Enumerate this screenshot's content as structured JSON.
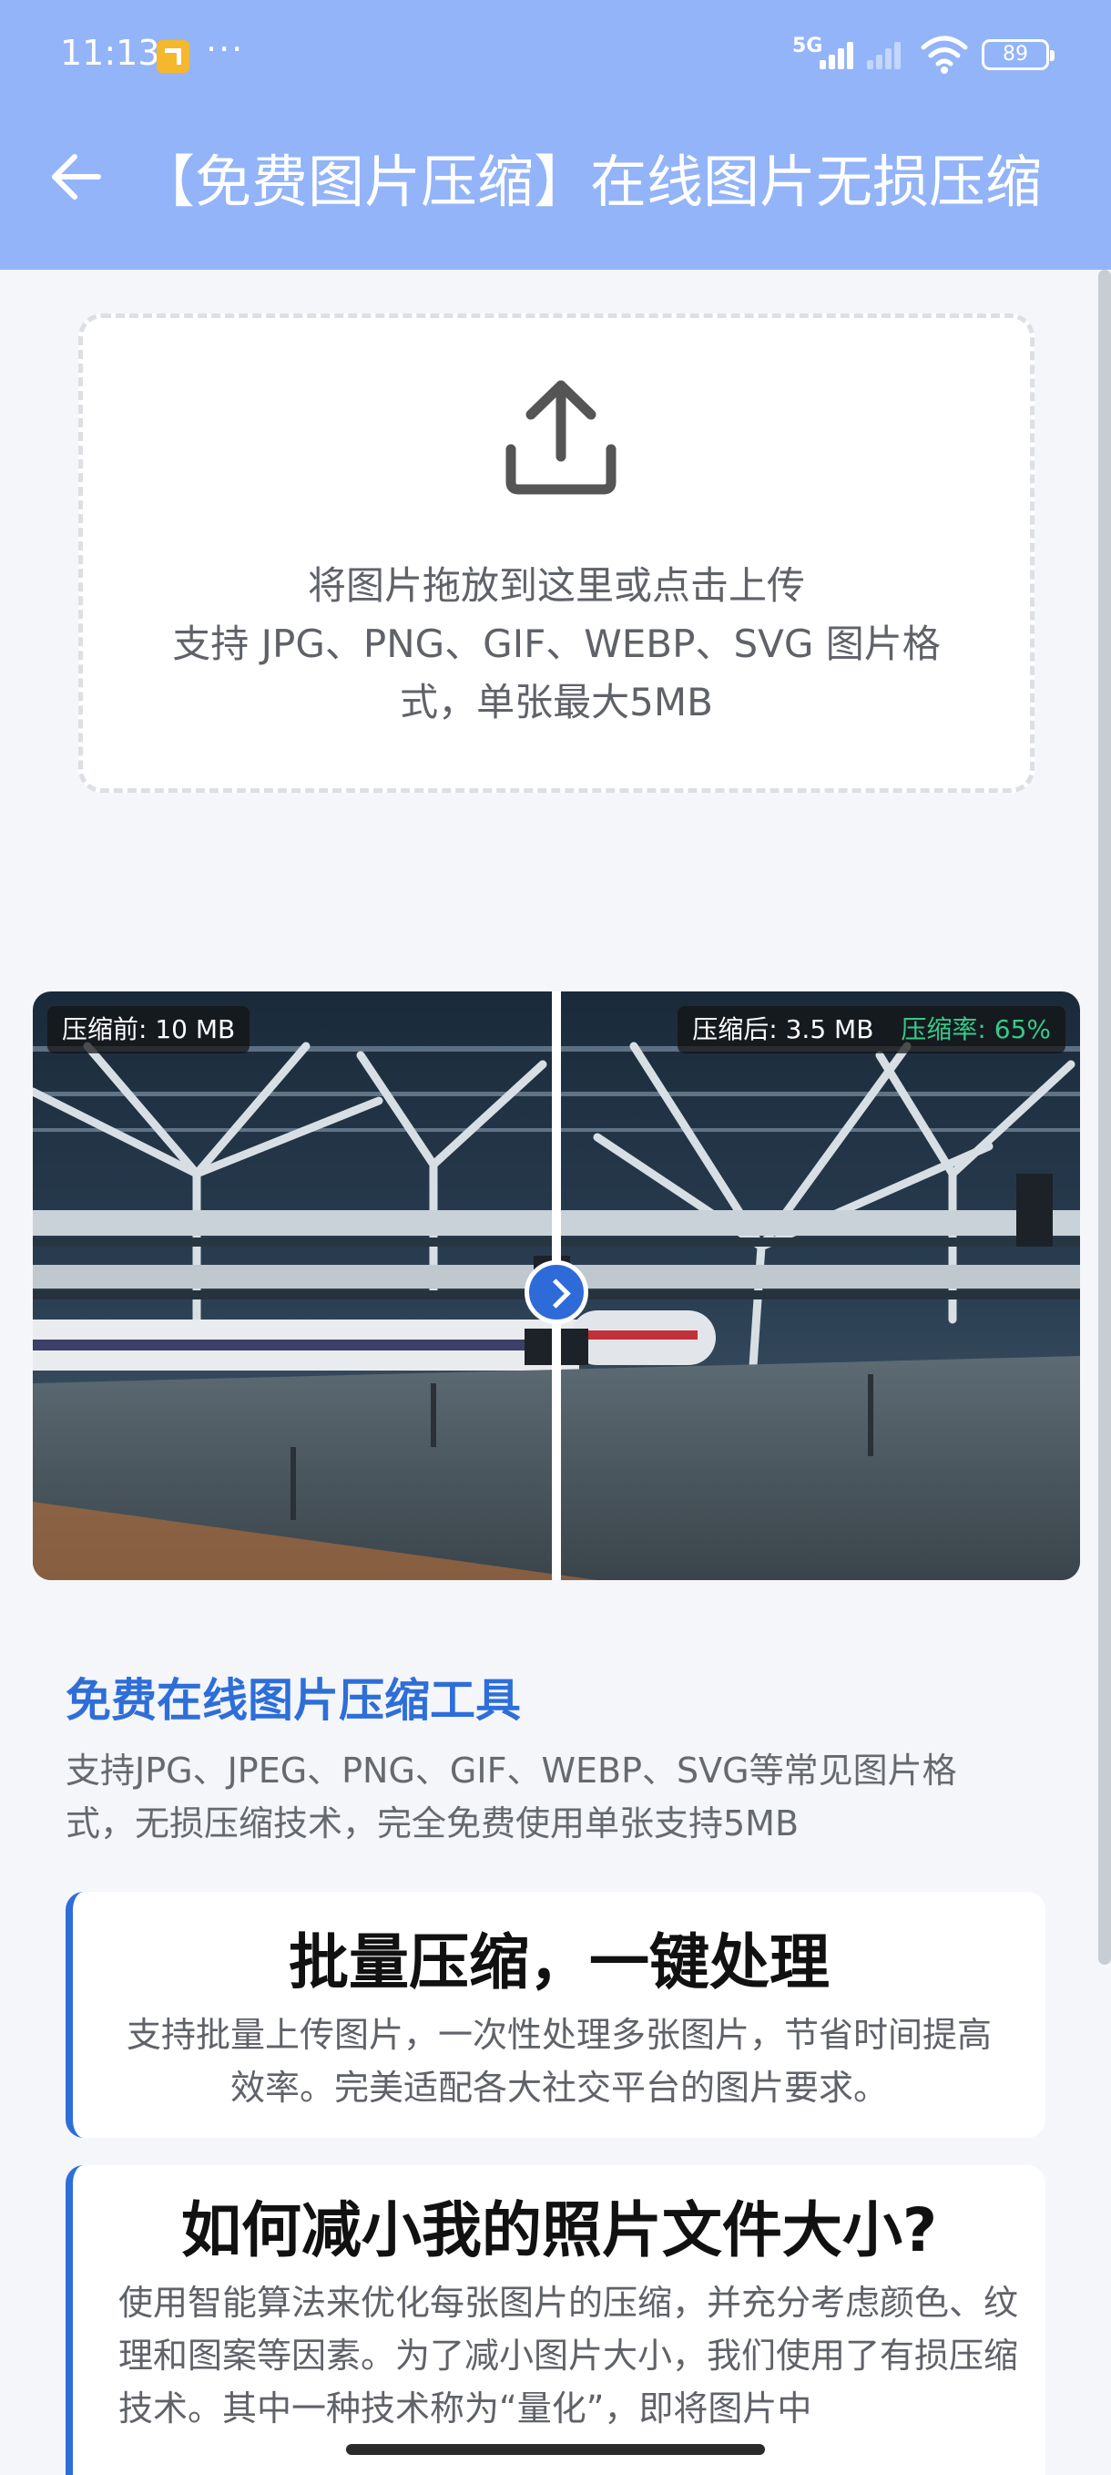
{
  "status_bar": {
    "time": "11:13",
    "dots": "···",
    "network": "5G",
    "battery": "89"
  },
  "app_bar": {
    "back_icon": "arrow-left-icon",
    "title": "【免费图片压缩】在线图片无损压缩"
  },
  "upload": {
    "icon": "upload-icon",
    "line1": "将图片拖放到这里或点击上传",
    "line2": "支持 JPG、PNG、GIF、WEBP、SVG 图片格式，单张最大5MB"
  },
  "compare": {
    "before_label": "压缩前: 10 MB",
    "after_label": "压缩后: 3.5 MB",
    "rate_label": "压缩率: 65%",
    "rate_color": "#37c98a",
    "handle_icon": "chevron-right-icon"
  },
  "tool": {
    "heading": "免费在线图片压缩工具",
    "desc": "支持JPG、JPEG、PNG、GIF、WEBP、SVG等常见图片格式，无损压缩技术，完全免费使用单张支持5MB"
  },
  "features": [
    {
      "title": "批量压缩，一键处理",
      "text": "支持批量上传图片，一次性处理多张图片，节省时间提高效率。完美适配各大社交平台的图片要求。"
    },
    {
      "title": "如何减小我的照片文件大小?",
      "text": "使用智能算法来优化每张图片的压缩，并充分考虑颜色、纹理和图案等因素。为了减小图片大小，我们使用了有损压缩技术。其中一种技术称为“量化”，即将图片中"
    }
  ],
  "colors": {
    "app_bar": "#93b4f8",
    "accent": "#2e6ed8"
  }
}
